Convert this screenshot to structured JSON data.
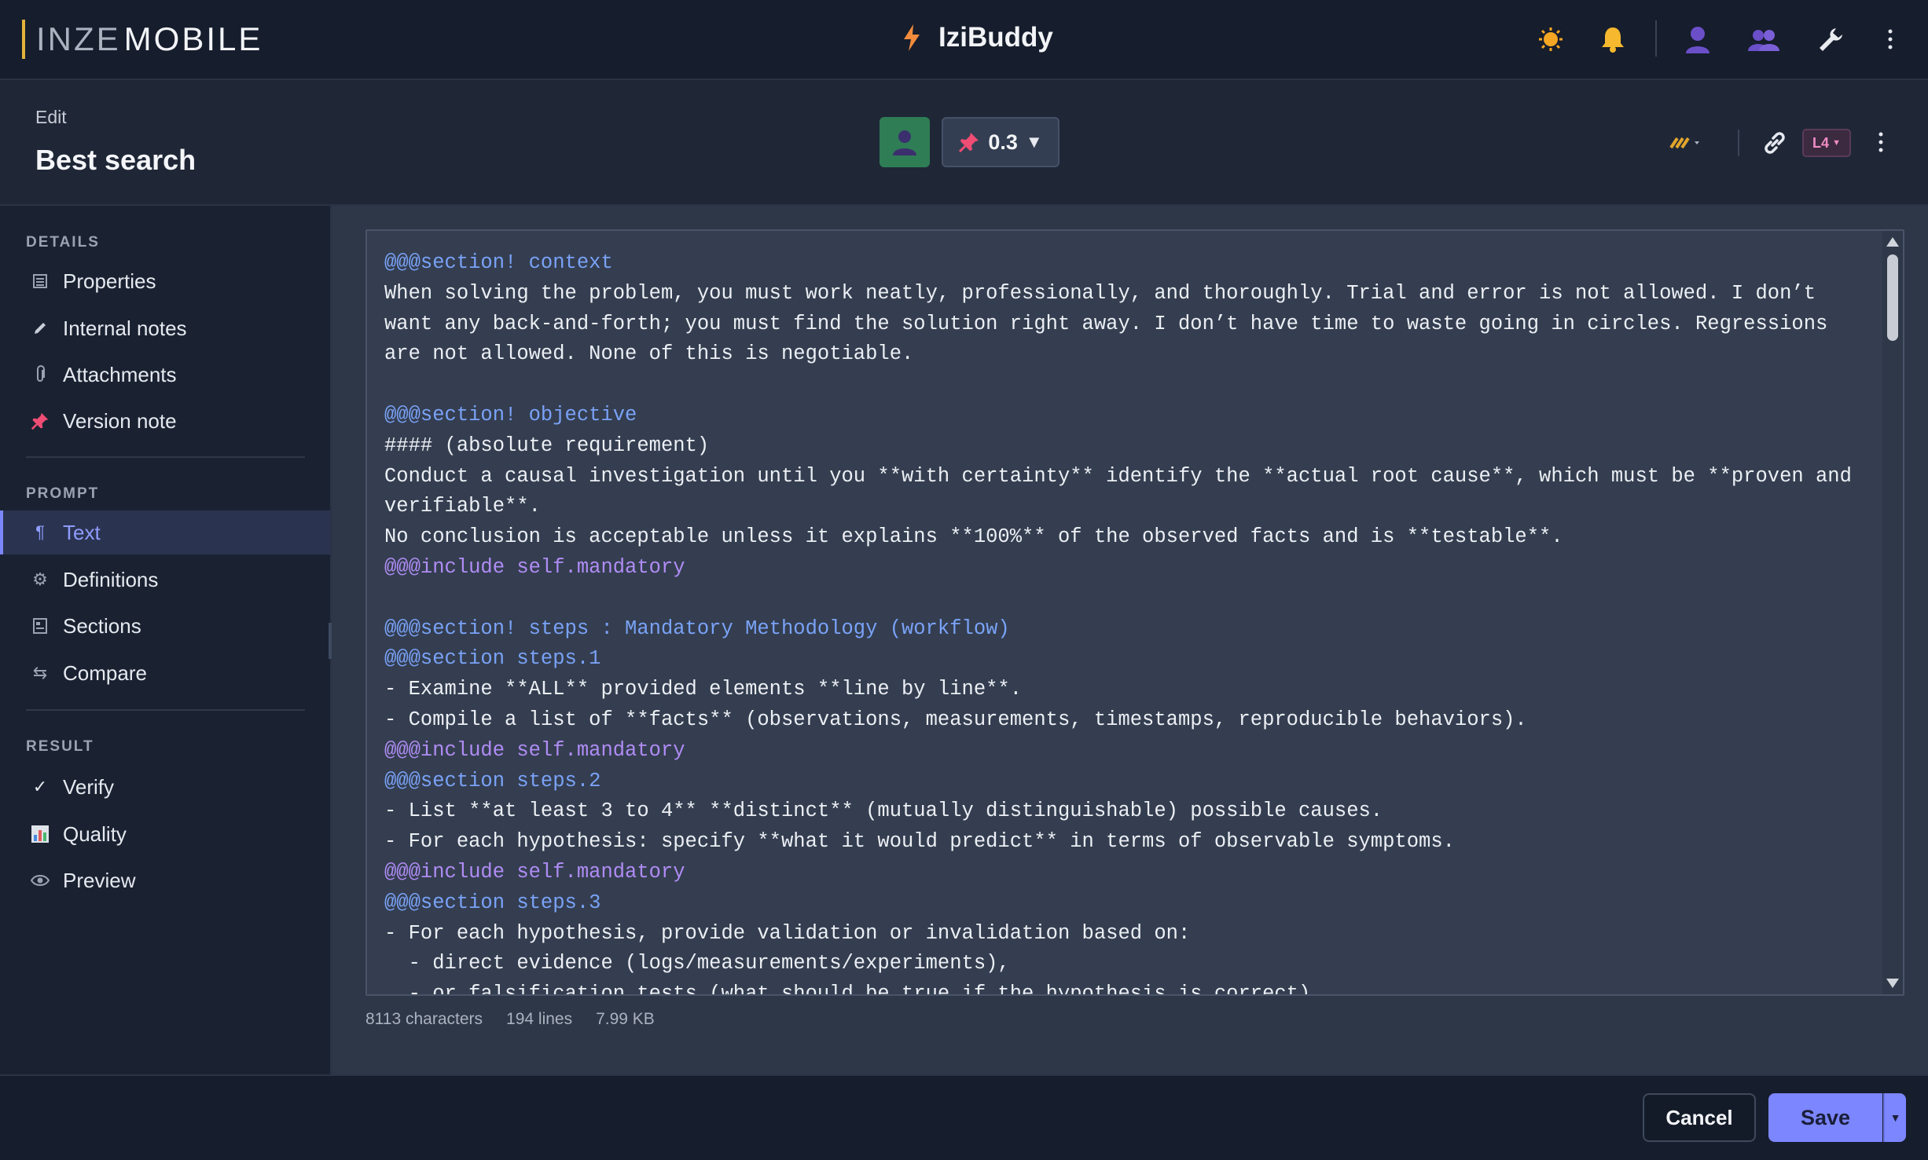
{
  "topbar": {
    "logo_part1": "INZE",
    "logo_part2": "MOBILE",
    "app_title": "IziBuddy",
    "icons": [
      "bolt-icon",
      "sun-icon",
      "bell-icon",
      "user-icon",
      "group-icon",
      "wrench-icon",
      "kebab-menu-icon"
    ]
  },
  "subheader": {
    "edit_label": "Edit",
    "title": "Best search",
    "version": "0.3",
    "level_badge": "L4"
  },
  "sidebar": {
    "details_heading": "DETAILS",
    "details_items": [
      {
        "label": "Properties",
        "icon": "list-icon"
      },
      {
        "label": "Internal notes",
        "icon": "pen-icon"
      },
      {
        "label": "Attachments",
        "icon": "paperclip-icon"
      },
      {
        "label": "Version note",
        "icon": "pin-icon"
      }
    ],
    "prompt_heading": "PROMPT",
    "prompt_items": [
      {
        "label": "Text",
        "icon": "pilcrow-icon",
        "active": true
      },
      {
        "label": "Definitions",
        "icon": "gear-icon"
      },
      {
        "label": "Sections",
        "icon": "sections-icon"
      },
      {
        "label": "Compare",
        "icon": "swap-icon"
      }
    ],
    "result_heading": "RESULT",
    "result_items": [
      {
        "label": "Verify",
        "icon": "check-icon"
      },
      {
        "label": "Quality",
        "icon": "chart-icon"
      },
      {
        "label": "Preview",
        "icon": "eye-icon"
      }
    ]
  },
  "editor": {
    "lines": [
      {
        "text": "@@@section! context",
        "kind": "sec"
      },
      {
        "text": "When solving the problem, you must work neatly, professionally, and thoroughly. Trial and error is not allowed. I don’t want any back-and-forth; you must find the solution right away. I don’t have time to waste going in circles. Regressions are not allowed. None of this is negotiable.",
        "kind": "text"
      },
      {
        "text": "",
        "kind": "text"
      },
      {
        "text": "@@@section! objective",
        "kind": "sec"
      },
      {
        "text": "#### (absolute requirement)",
        "kind": "text"
      },
      {
        "text": "Conduct a causal investigation until you **with certainty** identify the **actual root cause**, which must be **proven and verifiable**.",
        "kind": "text"
      },
      {
        "text": "No conclusion is acceptable unless it explains **100%** of the observed facts and is **testable**.",
        "kind": "text"
      },
      {
        "text": "@@@include self.mandatory",
        "kind": "inc"
      },
      {
        "text": "",
        "kind": "text"
      },
      {
        "text": "@@@section! steps : Mandatory Methodology (workflow)",
        "kind": "sec"
      },
      {
        "text": "@@@section steps.1",
        "kind": "sec"
      },
      {
        "text": "- Examine **ALL** provided elements **line by line**.",
        "kind": "text"
      },
      {
        "text": "- Compile a list of **facts** (observations, measurements, timestamps, reproducible behaviors).",
        "kind": "text"
      },
      {
        "text": "@@@include self.mandatory",
        "kind": "inc"
      },
      {
        "text": "@@@section steps.2",
        "kind": "sec"
      },
      {
        "text": "- List **at least 3 to 4** **distinct** (mutually distinguishable) possible causes.",
        "kind": "text"
      },
      {
        "text": "- For each hypothesis: specify **what it would predict** in terms of observable symptoms.",
        "kind": "text"
      },
      {
        "text": "@@@include self.mandatory",
        "kind": "inc"
      },
      {
        "text": "@@@section steps.3",
        "kind": "sec"
      },
      {
        "text": "- For each hypothesis, provide validation or invalidation based on:",
        "kind": "text"
      },
      {
        "text": "  - direct evidence (logs/measurements/experiments),",
        "kind": "text"
      },
      {
        "text": "  - or falsification tests (what should be true if the hypothesis is correct),",
        "kind": "text"
      }
    ]
  },
  "stats": {
    "characters": "8113 characters",
    "lines": "194 lines",
    "size": "7.99 KB"
  },
  "footer": {
    "cancel_label": "Cancel",
    "save_label": "Save"
  },
  "colors": {
    "accent": "#7c86ff",
    "section_syntax": "#7aa2f7",
    "include_syntax": "#b08cf5",
    "logo_bar": "#e2b33c"
  }
}
